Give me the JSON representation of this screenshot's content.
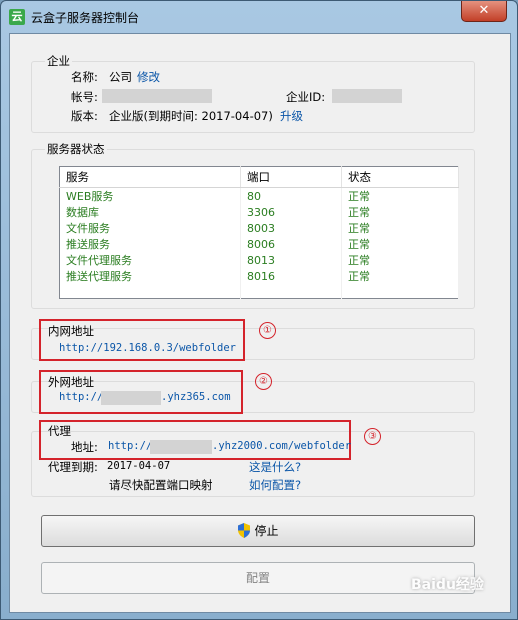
{
  "window": {
    "title": "云盒子服务器控制台",
    "close_label": "✕"
  },
  "company": {
    "group_label": "企业",
    "name_label": "名称:",
    "name_value": "公司",
    "edit_link": "修改",
    "account_label": "帐号:",
    "company_id_label": "企业ID:",
    "version_label": "版本:",
    "version_value": "企业版(到期时间: 2017-04-07)",
    "upgrade_link": "升级"
  },
  "services": {
    "group_label": "服务器状态",
    "columns": [
      "服务",
      "端口",
      "状态"
    ],
    "rows": [
      {
        "name": "WEB服务",
        "port": "80",
        "status": "正常"
      },
      {
        "name": "数据库",
        "port": "3306",
        "status": "正常"
      },
      {
        "name": "文件服务",
        "port": "8003",
        "status": "正常"
      },
      {
        "name": "推送服务",
        "port": "8006",
        "status": "正常"
      },
      {
        "name": "文件代理服务",
        "port": "8013",
        "status": "正常"
      },
      {
        "name": "推送代理服务",
        "port": "8016",
        "status": "正常"
      }
    ]
  },
  "intranet": {
    "label": "内网地址",
    "url": "http://192.168.0.3/webfolder",
    "marker": "①"
  },
  "internet": {
    "label": "外网地址",
    "url_prefix": "http://",
    "url_suffix": ".yhz365.com",
    "marker": "②"
  },
  "proxy": {
    "label": "代理",
    "address_label": "地址:",
    "url_prefix": "http://",
    "url_suffix": ".yhz2000.com/webfolder",
    "marker": "③",
    "expiry_label": "代理到期:",
    "expiry_value": "2017-04-07",
    "what_link": "这是什么?",
    "notice": "请尽快配置端口映射",
    "how_link": "如何配置?"
  },
  "buttons": {
    "stop": "停止",
    "configure": "配置"
  },
  "watermark": "Baidu经验"
}
